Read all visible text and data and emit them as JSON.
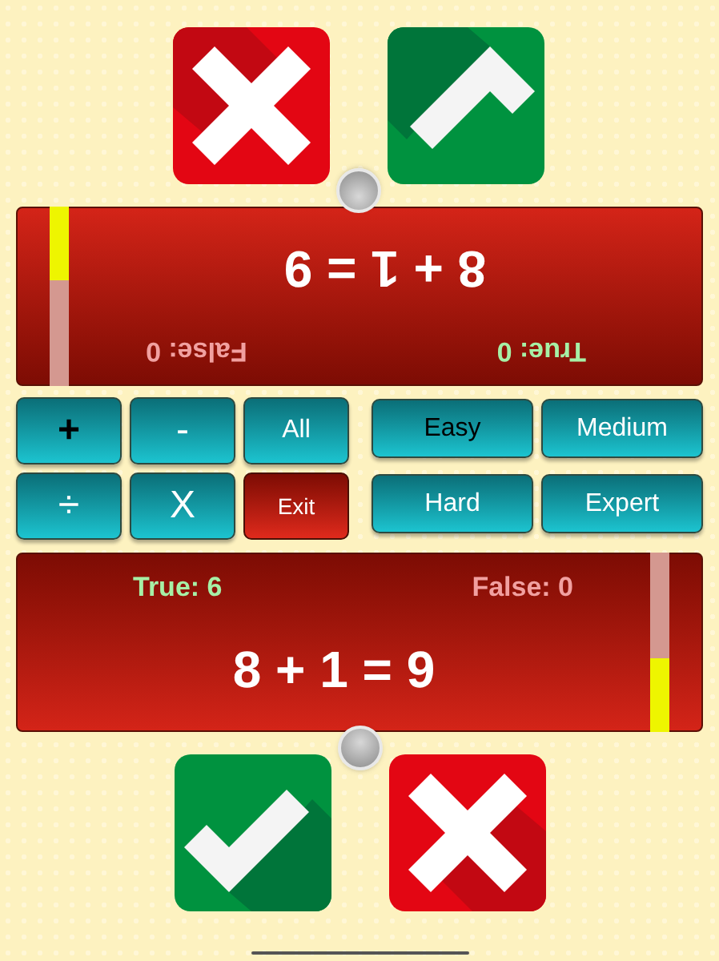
{
  "players": [
    {
      "flipped": true,
      "equation": "8 + 1 = 9",
      "true_label": "True: 0",
      "false_label": "False: 0",
      "level": 0.41,
      "answer_buttons": [
        {
          "kind": "right"
        },
        {
          "kind": "wrong"
        }
      ]
    },
    {
      "flipped": false,
      "equation": "8 + 1 = 9",
      "true_label": "True: 6",
      "false_label": "False: 0",
      "level": 0.41,
      "answer_buttons": [
        {
          "kind": "right"
        },
        {
          "kind": "wrong"
        }
      ]
    }
  ],
  "operations": [
    {
      "label": "+",
      "kind": "operation",
      "selected": true
    },
    {
      "label": "-",
      "kind": "operation",
      "selected": false
    },
    {
      "label": "All",
      "kind": "operation",
      "selected": false
    },
    {
      "label": "÷",
      "kind": "operation",
      "selected": false
    },
    {
      "label": "X",
      "kind": "operation",
      "selected": false
    },
    {
      "label": "Exit",
      "kind": "exit",
      "selected": false
    }
  ],
  "levels": [
    {
      "label": "Easy",
      "selected": true
    },
    {
      "label": "Medium",
      "selected": false
    },
    {
      "label": "Hard",
      "selected": false
    },
    {
      "label": "Expert",
      "selected": false
    }
  ]
}
